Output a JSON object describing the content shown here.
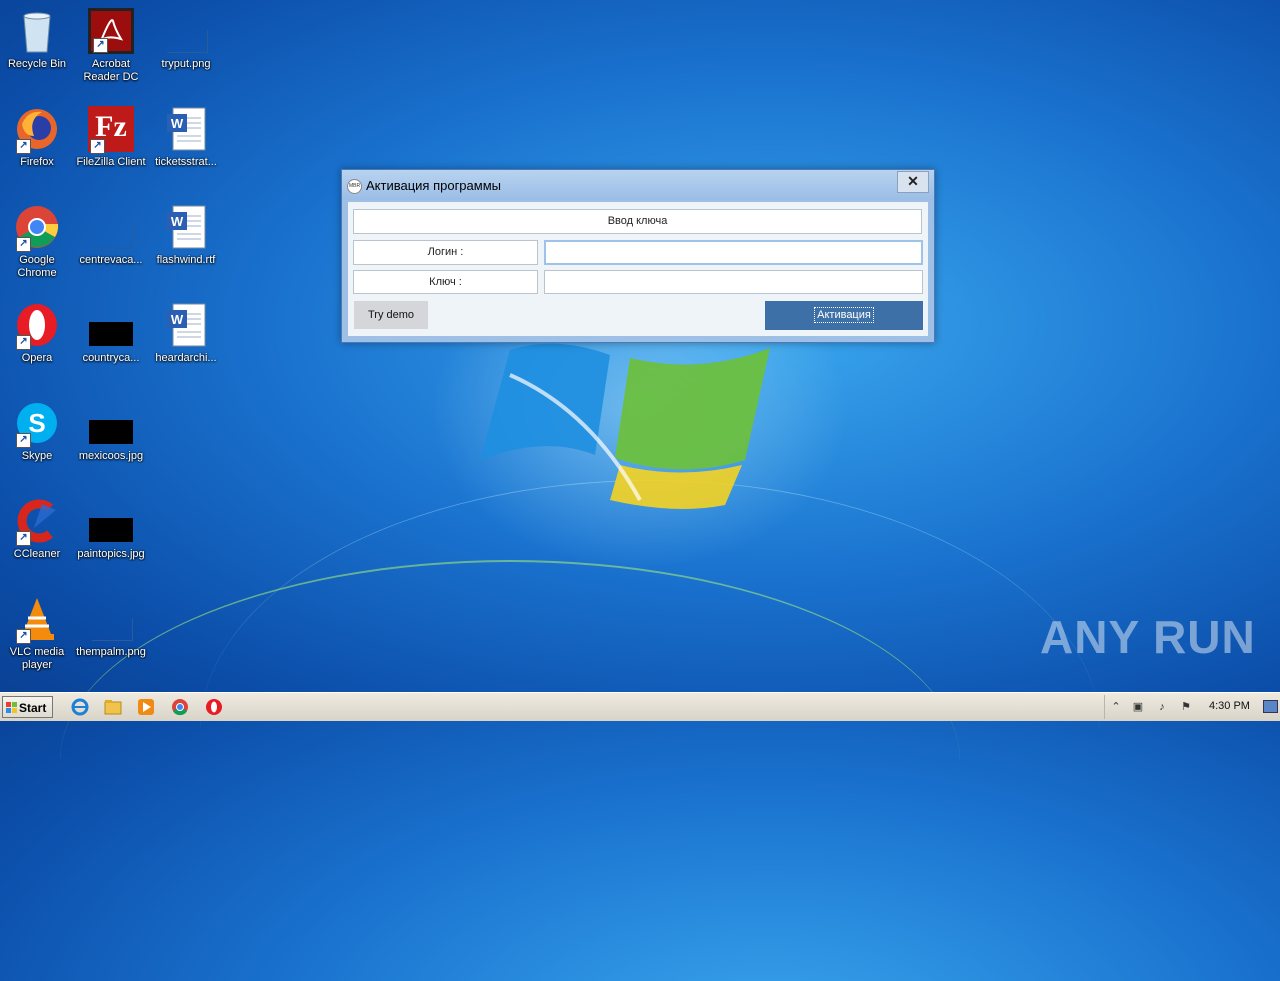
{
  "desktop": {
    "icons": [
      {
        "label": "Recycle Bin",
        "icon": "recycle-bin-icon"
      },
      {
        "label": "Acrobat Reader DC",
        "icon": "acrobat-icon"
      },
      {
        "label": "tryput.png",
        "icon": "image-file-icon"
      },
      {
        "label": "Firefox",
        "icon": "firefox-icon"
      },
      {
        "label": "FileZilla Client",
        "icon": "filezilla-icon"
      },
      {
        "label": "ticketsstrat...",
        "icon": "word-doc-icon"
      },
      {
        "label": "Google Chrome",
        "icon": "chrome-icon"
      },
      {
        "label": "centrevaca...",
        "icon": "image-file-icon"
      },
      {
        "label": "flashwind.rtf",
        "icon": "word-doc-icon"
      },
      {
        "label": "Opera",
        "icon": "opera-icon"
      },
      {
        "label": "countryca...",
        "icon": "image-file-icon"
      },
      {
        "label": "heardarchi...",
        "icon": "word-doc-icon"
      },
      {
        "label": "Skype",
        "icon": "skype-icon"
      },
      {
        "label": "mexicoos.jpg",
        "icon": "image-file-icon"
      },
      {
        "label": "CCleaner",
        "icon": "ccleaner-icon"
      },
      {
        "label": "paintopics.jpg",
        "icon": "image-file-icon"
      },
      {
        "label": "VLC media player",
        "icon": "vlc-icon"
      },
      {
        "label": "thempalm.png",
        "icon": "image-file-icon"
      }
    ]
  },
  "dialog": {
    "title": "Активация программы",
    "app_icon_text": "MBR",
    "close_glyph": "✕",
    "header_label": "Ввод ключа",
    "login_label": "Логин :",
    "login_value": "",
    "key_label": "Ключ :",
    "key_value": "",
    "demo_button": "Try demo",
    "activate_button": "Активация"
  },
  "taskbar": {
    "start_label": "Start",
    "pinned": [
      "internet-explorer-icon",
      "file-explorer-icon",
      "media-player-icon",
      "chrome-icon",
      "opera-icon"
    ],
    "tray": {
      "time": "4:30 PM"
    }
  },
  "watermark": "ANY RUN",
  "colors": {
    "accent": "#3e70a8",
    "title_bar": "#9bbde6"
  }
}
